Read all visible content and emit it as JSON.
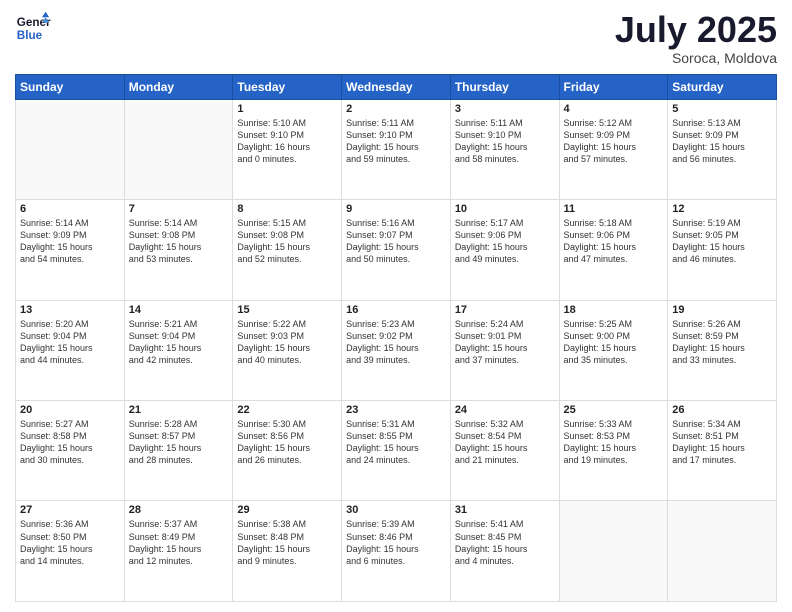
{
  "logo": {
    "line1": "General",
    "line2": "Blue"
  },
  "title": "July 2025",
  "subtitle": "Soroca, Moldova",
  "days_of_week": [
    "Sunday",
    "Monday",
    "Tuesday",
    "Wednesday",
    "Thursday",
    "Friday",
    "Saturday"
  ],
  "weeks": [
    [
      {
        "day": "",
        "content": ""
      },
      {
        "day": "",
        "content": ""
      },
      {
        "day": "1",
        "content": "Sunrise: 5:10 AM\nSunset: 9:10 PM\nDaylight: 16 hours\nand 0 minutes."
      },
      {
        "day": "2",
        "content": "Sunrise: 5:11 AM\nSunset: 9:10 PM\nDaylight: 15 hours\nand 59 minutes."
      },
      {
        "day": "3",
        "content": "Sunrise: 5:11 AM\nSunset: 9:10 PM\nDaylight: 15 hours\nand 58 minutes."
      },
      {
        "day": "4",
        "content": "Sunrise: 5:12 AM\nSunset: 9:09 PM\nDaylight: 15 hours\nand 57 minutes."
      },
      {
        "day": "5",
        "content": "Sunrise: 5:13 AM\nSunset: 9:09 PM\nDaylight: 15 hours\nand 56 minutes."
      }
    ],
    [
      {
        "day": "6",
        "content": "Sunrise: 5:14 AM\nSunset: 9:09 PM\nDaylight: 15 hours\nand 54 minutes."
      },
      {
        "day": "7",
        "content": "Sunrise: 5:14 AM\nSunset: 9:08 PM\nDaylight: 15 hours\nand 53 minutes."
      },
      {
        "day": "8",
        "content": "Sunrise: 5:15 AM\nSunset: 9:08 PM\nDaylight: 15 hours\nand 52 minutes."
      },
      {
        "day": "9",
        "content": "Sunrise: 5:16 AM\nSunset: 9:07 PM\nDaylight: 15 hours\nand 50 minutes."
      },
      {
        "day": "10",
        "content": "Sunrise: 5:17 AM\nSunset: 9:06 PM\nDaylight: 15 hours\nand 49 minutes."
      },
      {
        "day": "11",
        "content": "Sunrise: 5:18 AM\nSunset: 9:06 PM\nDaylight: 15 hours\nand 47 minutes."
      },
      {
        "day": "12",
        "content": "Sunrise: 5:19 AM\nSunset: 9:05 PM\nDaylight: 15 hours\nand 46 minutes."
      }
    ],
    [
      {
        "day": "13",
        "content": "Sunrise: 5:20 AM\nSunset: 9:04 PM\nDaylight: 15 hours\nand 44 minutes."
      },
      {
        "day": "14",
        "content": "Sunrise: 5:21 AM\nSunset: 9:04 PM\nDaylight: 15 hours\nand 42 minutes."
      },
      {
        "day": "15",
        "content": "Sunrise: 5:22 AM\nSunset: 9:03 PM\nDaylight: 15 hours\nand 40 minutes."
      },
      {
        "day": "16",
        "content": "Sunrise: 5:23 AM\nSunset: 9:02 PM\nDaylight: 15 hours\nand 39 minutes."
      },
      {
        "day": "17",
        "content": "Sunrise: 5:24 AM\nSunset: 9:01 PM\nDaylight: 15 hours\nand 37 minutes."
      },
      {
        "day": "18",
        "content": "Sunrise: 5:25 AM\nSunset: 9:00 PM\nDaylight: 15 hours\nand 35 minutes."
      },
      {
        "day": "19",
        "content": "Sunrise: 5:26 AM\nSunset: 8:59 PM\nDaylight: 15 hours\nand 33 minutes."
      }
    ],
    [
      {
        "day": "20",
        "content": "Sunrise: 5:27 AM\nSunset: 8:58 PM\nDaylight: 15 hours\nand 30 minutes."
      },
      {
        "day": "21",
        "content": "Sunrise: 5:28 AM\nSunset: 8:57 PM\nDaylight: 15 hours\nand 28 minutes."
      },
      {
        "day": "22",
        "content": "Sunrise: 5:30 AM\nSunset: 8:56 PM\nDaylight: 15 hours\nand 26 minutes."
      },
      {
        "day": "23",
        "content": "Sunrise: 5:31 AM\nSunset: 8:55 PM\nDaylight: 15 hours\nand 24 minutes."
      },
      {
        "day": "24",
        "content": "Sunrise: 5:32 AM\nSunset: 8:54 PM\nDaylight: 15 hours\nand 21 minutes."
      },
      {
        "day": "25",
        "content": "Sunrise: 5:33 AM\nSunset: 8:53 PM\nDaylight: 15 hours\nand 19 minutes."
      },
      {
        "day": "26",
        "content": "Sunrise: 5:34 AM\nSunset: 8:51 PM\nDaylight: 15 hours\nand 17 minutes."
      }
    ],
    [
      {
        "day": "27",
        "content": "Sunrise: 5:36 AM\nSunset: 8:50 PM\nDaylight: 15 hours\nand 14 minutes."
      },
      {
        "day": "28",
        "content": "Sunrise: 5:37 AM\nSunset: 8:49 PM\nDaylight: 15 hours\nand 12 minutes."
      },
      {
        "day": "29",
        "content": "Sunrise: 5:38 AM\nSunset: 8:48 PM\nDaylight: 15 hours\nand 9 minutes."
      },
      {
        "day": "30",
        "content": "Sunrise: 5:39 AM\nSunset: 8:46 PM\nDaylight: 15 hours\nand 6 minutes."
      },
      {
        "day": "31",
        "content": "Sunrise: 5:41 AM\nSunset: 8:45 PM\nDaylight: 15 hours\nand 4 minutes."
      },
      {
        "day": "",
        "content": ""
      },
      {
        "day": "",
        "content": ""
      }
    ]
  ]
}
